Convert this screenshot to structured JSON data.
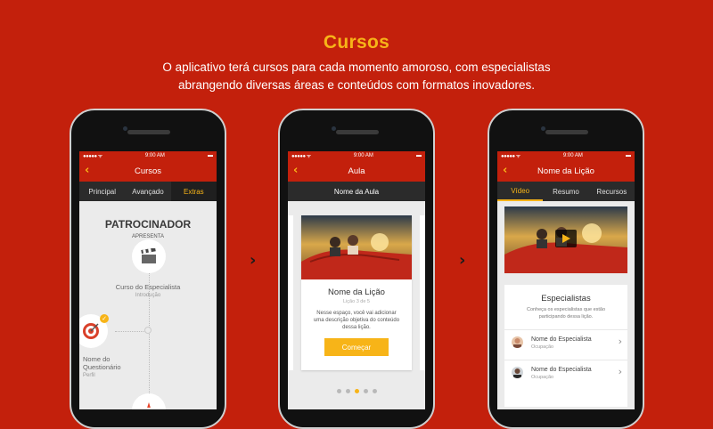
{
  "title": "Cursos",
  "description": "O aplicativo terá cursos para cada momento amoroso, com especialistas abrangendo diversas áreas e conteúdos com formatos inovadores.",
  "description_line1": "O aplicativo terá cursos para cada momento amoroso, com especialistas",
  "description_line2": "abrangendo diversas áreas e conteúdos com formatos inovadores.",
  "status_time": "9:00 AM",
  "colors": {
    "brand_red": "#c3200c",
    "accent_yellow": "#f7b418",
    "dark_bar": "#2b2b2b"
  },
  "phone1": {
    "nav_title": "Cursos",
    "tabs": [
      "Principal",
      "Avançado",
      "Extras"
    ],
    "active_tab": "Extras",
    "sponsor": "PATROCINADOR",
    "presents": "APRESENTA",
    "course_title": "Curso do Especialista",
    "course_sub": "Introdução",
    "quiz_title_line1": "Nome do",
    "quiz_title_line2": "Questionário",
    "quiz_sub": "Perfil"
  },
  "phone2": {
    "nav_title": "Aula",
    "subheader": "Nome da Aula",
    "lesson_title": "Nome da Lição",
    "lesson_number": "Lição 3 de 5",
    "lesson_desc": "Nesse espaço, você vai adicionar uma descrição objetiva do conteúdo dessa lição.",
    "start_button": "Começar",
    "page_dots": 5,
    "active_dot": 3
  },
  "phone3": {
    "nav_title": "Nome da Lição",
    "tabs": [
      "Vídeo",
      "Resumo",
      "Recursos"
    ],
    "active_tab": "Vídeo",
    "panel_title": "Especialistas",
    "panel_sub": "Conheça os especialistas que estão participando dessa lição.",
    "specialists": [
      {
        "name": "Nome do Especialista",
        "occupation": "Ocupação"
      },
      {
        "name": "Nome do Especialista",
        "occupation": "Ocupação"
      }
    ]
  },
  "icons": [
    "back-chevron-icon",
    "film-clapper-icon",
    "target-icon",
    "check-badge-icon",
    "traffic-cone-icon",
    "play-icon",
    "chevron-right-icon",
    "next-arrow-icon",
    "wifi-icon",
    "battery-icon"
  ]
}
